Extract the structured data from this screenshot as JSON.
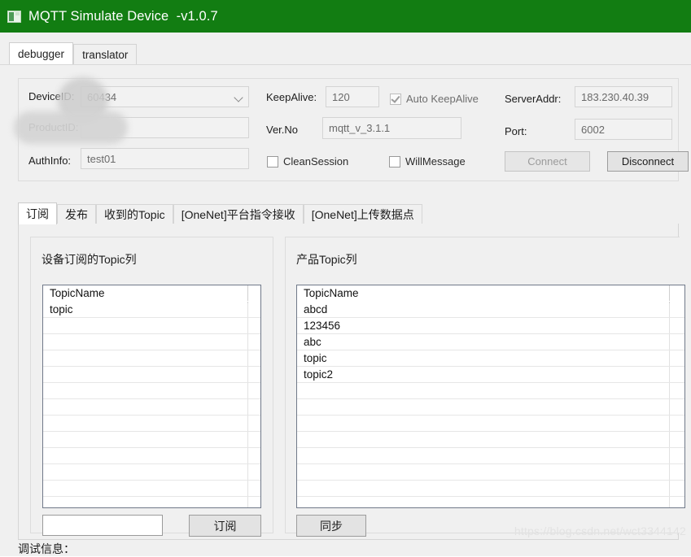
{
  "window": {
    "title": "MQTT Simulate Device  -v1.0.7",
    "icon": "app-window-icon",
    "title_bar_color": "#127d12"
  },
  "top_tabs": [
    {
      "label": "debugger",
      "active": true
    },
    {
      "label": "translator",
      "active": false
    }
  ],
  "connection": {
    "device_id": {
      "label": "DeviceID:",
      "value": "60434",
      "redacted": true
    },
    "product_id": {
      "label": "ProductID:",
      "value": "",
      "redacted": true
    },
    "auth_info": {
      "label": "AuthInfo:",
      "value": "test01"
    },
    "keep_alive": {
      "label": "KeepAlive:",
      "value": "120"
    },
    "auto_keep_alive": {
      "label": "Auto KeepAlive",
      "checked": true,
      "disabled": true
    },
    "ver_no": {
      "label": "Ver.No",
      "value": "mqtt_v_3.1.1"
    },
    "clean_session": {
      "label": "CleanSession",
      "checked": false
    },
    "will_message": {
      "label": "WillMessage",
      "checked": false
    },
    "server_addr": {
      "label": "ServerAddr:",
      "value": "183.230.40.39"
    },
    "port": {
      "label": "Port:",
      "value": "6002"
    },
    "connect_button": {
      "label": "Connect",
      "disabled": true
    },
    "disconnect_button": {
      "label": "Disconnect",
      "disabled": false
    }
  },
  "inner_tabs": [
    {
      "label": "订阅",
      "active": true
    },
    {
      "label": "发布",
      "active": false
    },
    {
      "label": "收到的Topic",
      "active": false
    },
    {
      "label": "[OneNet]平台指令接收",
      "active": false
    },
    {
      "label": "[OneNet]上传数据点",
      "active": false
    }
  ],
  "device_topics": {
    "group_title": "设备订阅的Topic列",
    "column_header": "TopicName",
    "rows": [
      "topic"
    ],
    "input_value": "",
    "subscribe_button": "订阅"
  },
  "product_topics": {
    "group_title": "产品Topic列",
    "column_header": "TopicName",
    "rows": [
      "abcd",
      "123456",
      "abc",
      "topic",
      "topic2"
    ],
    "sync_button": "同步"
  },
  "footer": {
    "debug_label": "调试信息：",
    "watermark": "https://blog.csdn.net/wct3344142"
  }
}
